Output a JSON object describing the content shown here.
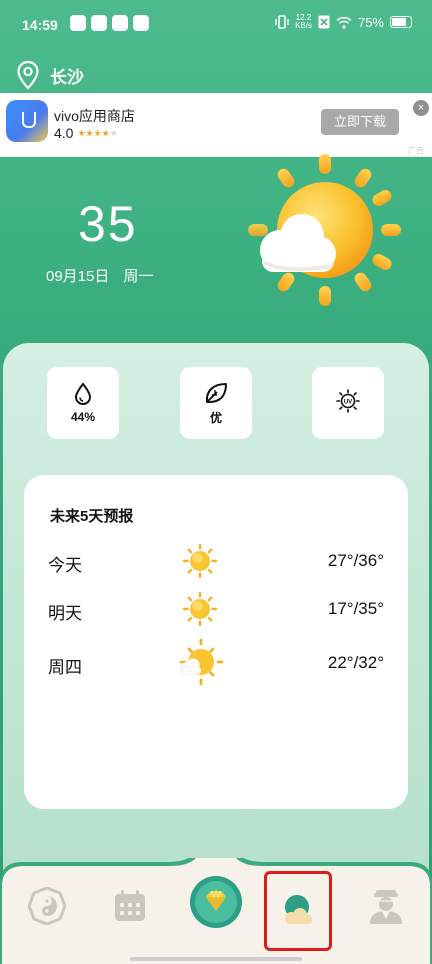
{
  "status_bar": {
    "time": "14:59",
    "net_speed_top": "12.2",
    "net_speed_bottom": "KB/s",
    "battery": "75%"
  },
  "location": {
    "city": "长沙",
    "icon": "location-pin-icon"
  },
  "ad": {
    "title": "vivo应用商店",
    "rating": "4.0",
    "stars_filled": 4,
    "stars_total": 5,
    "button": "立即下载",
    "close": "×",
    "tag": "广告"
  },
  "weather": {
    "temperature": "35",
    "date": "09月15日",
    "weekday": "周一",
    "icon": "sun-cloud-icon"
  },
  "stats": [
    {
      "icon": "humidity-drop-icon",
      "value": "44%"
    },
    {
      "icon": "air-quality-leaf-icon",
      "value": "优"
    },
    {
      "icon": "uv-index-icon",
      "value": ""
    }
  ],
  "forecast": {
    "title": "未来5天预报",
    "days": [
      {
        "day": "今天",
        "icon": "sunny-icon",
        "range": "27°/36°"
      },
      {
        "day": "明天",
        "icon": "sunny-icon",
        "range": "17°/35°"
      },
      {
        "day": "周四",
        "icon": "sun-cloud-icon",
        "range": "22°/32°"
      }
    ]
  },
  "nav": [
    {
      "name": "bagua-icon"
    },
    {
      "name": "calendar-icon"
    },
    {
      "name": "diamond-icon"
    },
    {
      "name": "weather-icon"
    },
    {
      "name": "fortune-teller-icon"
    }
  ],
  "colors": {
    "brand_green": "#33a779",
    "panel_green": "#c5e8d8",
    "accent_teal": "#2c9f86",
    "highlight_red": "#d91e1e"
  }
}
